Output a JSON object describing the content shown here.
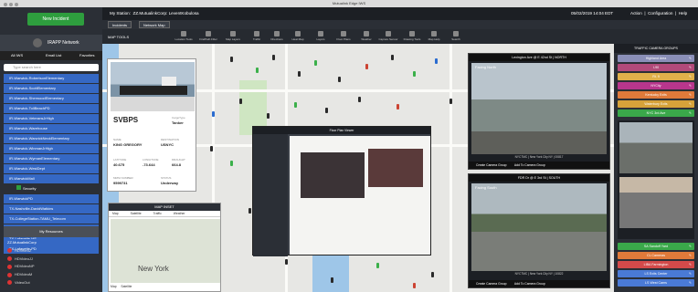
{
  "window": {
    "title": "Mutualink Edge IWS"
  },
  "left_panel": {
    "new_incident": "New Incident",
    "network_title": "IRAPP Network",
    "tabs": [
      "All IWS",
      "Email List",
      "Favorites"
    ],
    "search_placeholder": "Type search here",
    "tree": [
      "IR-Warwick-RobertsonElementary",
      "IR-Warwick-ScottElementary",
      "IR-Warwick-SherwoodElementary",
      "IR-Warwick-ToliBeachPD",
      "IR-Warwick-VeteransJrHigh",
      "IR-Warwick-Warehouse",
      "IR-Warwick-WarwickNeckElementary",
      "IR-Warwick-WinmanJrHigh",
      "IR-Warwick-WymanElementary",
      "IR-Warwick-WestDept",
      "IR-WarwickMall"
    ],
    "security_label": "Security",
    "tree2": [
      "IR-WarwickPD",
      "TX-Nashville-DavidWatkins",
      "TX-CollegeStation-TAMU_Telecom",
      "TX-GalvestonCo",
      "TX-Lafayette-HS",
      "TX-Lafayette-PD"
    ],
    "my_resources": "My Resources",
    "resources": [
      "ZZ.MutualinkCorp",
      "HDVideoZ",
      "HDVideoJJ",
      "HDVideoNP",
      "HDVideoM",
      "VideoOut"
    ]
  },
  "topbar": {
    "station_label": "My Station:",
    "station_value": "ZZ.MutualinkCorp: LeventKobulosa",
    "datetime": "05/02/2019 14:04 EDT",
    "menu": [
      "Action",
      "Configuration",
      "Help"
    ]
  },
  "subtabs": [
    "Incidents",
    "Network Map"
  ],
  "map_tools": {
    "label": "MAP TOOLS",
    "tools": [
      "Location Tools",
      "FindPath Filter",
      "Map Layers",
      "Traffic",
      "Directions",
      "Heat Map",
      "Layers",
      "Floor Plans",
      "Weather",
      "Capture Sensor",
      "Drawing Tools",
      "Map Help",
      "Search"
    ]
  },
  "ship_card": {
    "name": "SVBPS",
    "cargo_type_label": "CargoType",
    "cargo_type": "Tanker",
    "name_label": "NAME",
    "ship_name": "KING GREGORY",
    "destination_label": "DESTINATION",
    "destination": "USNYC",
    "lat_label": "LATITUDE",
    "lat": "40.675",
    "lon_label": "LONGITUDE",
    "lon": "-73.644",
    "draught_label": "DRAUGHT",
    "draught": "664.8",
    "mmsi_label": "MMSI NUMBER",
    "mmsi": "9599731",
    "status_label": "STATUS",
    "status": "Underway"
  },
  "map_inset": {
    "title": "MAP INSET",
    "tabs": [
      "Map",
      "Satellite",
      "Traffic",
      "Weather"
    ],
    "city": "New York",
    "bottom_tabs": [
      "Map",
      "Satellite"
    ]
  },
  "floor_plan": {
    "title": "Floor Plan Viewer"
  },
  "camera1": {
    "title": "Lexington Ave @ E 42nd St | NORTH",
    "overlay": "Facing North",
    "caption": "NYCTMC | New York City NY | 00817",
    "buttons": [
      "Create Camera Group",
      "Add To Camera Group"
    ]
  },
  "camera2": {
    "title": "FDR Dr @ E 3rd St | SOUTH",
    "overlay": "Facing South",
    "caption": "NYCTMC | New York City NY | 10822",
    "buttons": [
      "Create Camera Group",
      "Add To Camera Group"
    ]
  },
  "right_panel": {
    "title": "TRAFFIC CAMERA GROUPS",
    "groups": [
      {
        "name": "Highland Area",
        "color": "#8a8fb8"
      },
      {
        "name": "I-90",
        "color": "#b24a7a"
      },
      {
        "name": "Rt. 9",
        "color": "#e0b04a"
      },
      {
        "name": "NYCity",
        "color": "#b8368c"
      },
      {
        "name": "Kentucky Exits",
        "color": "#e07a3a"
      },
      {
        "name": "Waterbury Exits",
        "color": "#d6a23a"
      },
      {
        "name": "NYC 3rd Ave",
        "color": "#3aa84a"
      },
      {
        "name": "SA Sandoff Yard",
        "color": "#3aa84a"
      },
      {
        "name": "CL Cameras",
        "color": "#e07a3a"
      },
      {
        "name": "LIBA Farmington",
        "color": "#d44a4a"
      },
      {
        "name": "LS Exits Center",
        "color": "#4a7ad6"
      },
      {
        "name": "LS West Cams",
        "color": "#4a7ad6"
      }
    ]
  }
}
